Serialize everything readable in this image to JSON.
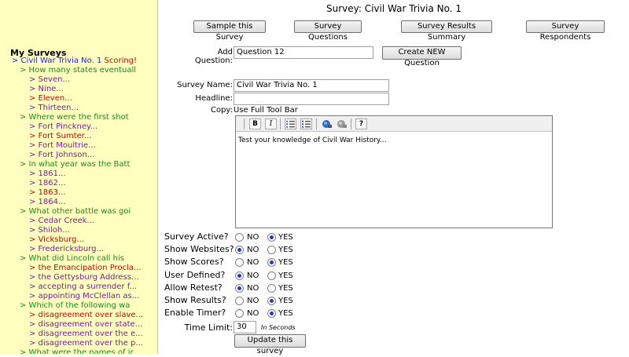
{
  "sidebar": {
    "title": "My Surveys",
    "items": [
      {
        "text": "> Civil War Trivia No. 1 ",
        "suffix": "Scoring!",
        "level": 0,
        "color": "blue"
      },
      {
        "text": "> How many states eventuall",
        "level": 1,
        "color": "green"
      },
      {
        "text": "> Seven...",
        "level": 2,
        "color": "purple"
      },
      {
        "text": "> Nine...",
        "level": 2,
        "color": "purple"
      },
      {
        "text": "> Eleven...",
        "level": 2,
        "color": "red"
      },
      {
        "text": "> Thirteen...",
        "level": 2,
        "color": "purple"
      },
      {
        "text": "> Where were the first shot",
        "level": 1,
        "color": "green"
      },
      {
        "text": "> Fort Pinckney...",
        "level": 2,
        "color": "purple"
      },
      {
        "text": "> Fort Sumter...",
        "level": 2,
        "color": "red"
      },
      {
        "text": "> Fort Moultrie...",
        "level": 2,
        "color": "purple"
      },
      {
        "text": "> Fort Johnson...",
        "level": 2,
        "color": "purple"
      },
      {
        "text": "> In what year was the Batt",
        "level": 1,
        "color": "green"
      },
      {
        "text": "> 1861...",
        "level": 2,
        "color": "purple"
      },
      {
        "text": "> 1862...",
        "level": 2,
        "color": "purple"
      },
      {
        "text": "> 1863...",
        "level": 2,
        "color": "red"
      },
      {
        "text": "> 1864...",
        "level": 2,
        "color": "purple"
      },
      {
        "text": "> What other battle was goi",
        "level": 1,
        "color": "green"
      },
      {
        "text": "> Cedar Creek...",
        "level": 2,
        "color": "purple"
      },
      {
        "text": "> Shiloh...",
        "level": 2,
        "color": "purple"
      },
      {
        "text": "> Vicksburg...",
        "level": 2,
        "color": "red"
      },
      {
        "text": "> Fredericksburg...",
        "level": 2,
        "color": "purple"
      },
      {
        "text": "> What did Lincoln call his",
        "level": 1,
        "color": "green"
      },
      {
        "text": "> the Emancipation Procla...",
        "level": 2,
        "color": "red"
      },
      {
        "text": "> the Gettysburg Address...",
        "level": 2,
        "color": "purple"
      },
      {
        "text": "> accepting a surrender f...",
        "level": 2,
        "color": "purple"
      },
      {
        "text": "> appointing McClellan as...",
        "level": 2,
        "color": "purple"
      },
      {
        "text": "> Which of the following wa",
        "level": 1,
        "color": "green"
      },
      {
        "text": "> disagreement over slave...",
        "level": 2,
        "color": "red"
      },
      {
        "text": "> disagreement over state...",
        "level": 2,
        "color": "purple"
      },
      {
        "text": "> disagreement over the e...",
        "level": 2,
        "color": "purple"
      },
      {
        "text": "> disagreement over the p...",
        "level": 2,
        "color": "purple"
      },
      {
        "text": "> What were the names of ir",
        "level": 1,
        "color": "green"
      }
    ]
  },
  "header": {
    "title": "Survey: Civil War Trivia No. 1",
    "buttons": {
      "sample": "Sample this Survey",
      "questions": "Survey Questions",
      "results": "Survey Results Summary",
      "respondents": "Survey Respondents"
    }
  },
  "add_question": {
    "label": "Add Question:",
    "value": "Question 12",
    "button": "Create NEW Question"
  },
  "form": {
    "survey_name_label": "Survey Name:",
    "survey_name_value": "Civil War Trivia No. 1",
    "headline_label": "Headline:",
    "headline_value": "",
    "copy_label": "Copy:",
    "copy_link": "Use Full Tool Bar",
    "editor_text": "Test your knowledge of Civil War History..."
  },
  "toolbar_icons": [
    "bold-icon",
    "italic-icon",
    "ordered-list-icon",
    "unordered-list-icon",
    "link-icon",
    "unlink-icon",
    "help-icon"
  ],
  "toolbar_labels": {
    "bold": "B",
    "italic": "I",
    "help": "?"
  },
  "options": {
    "no": "NO",
    "yes": "YES",
    "rows": [
      {
        "label": "Survey Active?",
        "selected": "yes"
      },
      {
        "label": "Show Websites?",
        "selected": "no"
      },
      {
        "label": "Show Scores?",
        "selected": "yes"
      },
      {
        "label": "User Defined?",
        "selected": "no"
      },
      {
        "label": "Allow Retest?",
        "selected": "no"
      },
      {
        "label": "Show Results?",
        "selected": "yes"
      },
      {
        "label": "Enable Timer?",
        "selected": "yes"
      }
    ]
  },
  "timer": {
    "label": "Time Limit:",
    "value": "30",
    "unit": "In Seconds"
  },
  "update_button": "Update this survey",
  "colors": {
    "sidebar_bg": "#ffffc0",
    "blue": "#1a1aff",
    "red": "#cc0000",
    "green": "#1a8a1a",
    "purple": "#7a1a9a"
  }
}
